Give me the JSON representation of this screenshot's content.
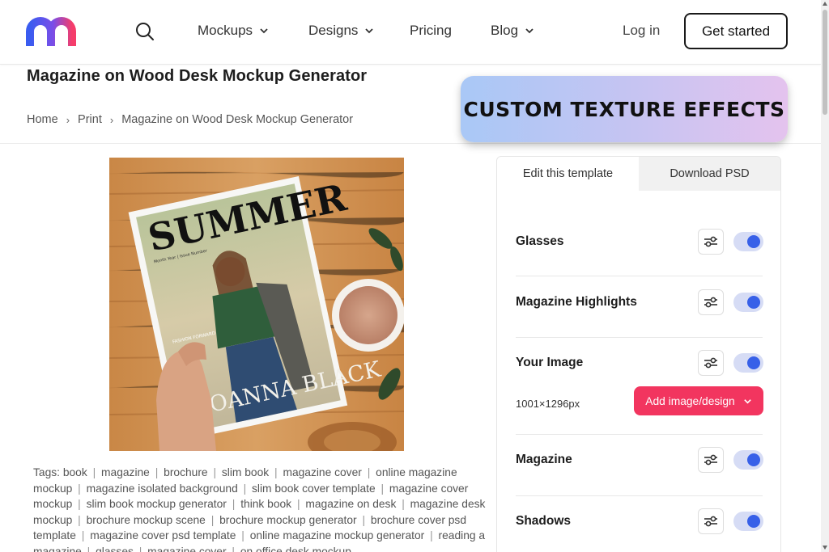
{
  "header": {
    "nav": [
      {
        "label": "Mockups",
        "has_dropdown": true
      },
      {
        "label": "Designs",
        "has_dropdown": true
      },
      {
        "label": "Pricing",
        "has_dropdown": false
      },
      {
        "label": "Blog",
        "has_dropdown": true
      }
    ],
    "login_label": "Log in",
    "cta_label": "Get started"
  },
  "page": {
    "title": "Magazine on Wood Desk Mockup Generator",
    "breadcrumb": [
      "Home",
      "Print",
      "Magazine on Wood Desk Mockup Generator"
    ]
  },
  "promo": {
    "text": "CUSTOM TEXTURE EFFECTS"
  },
  "mockup": {
    "cover_title": "SUMMER",
    "cover_name": "JOANNA BLACK",
    "cover_small": "Month Year | Issue Number",
    "cover_blurb": "FASHION FORWARD"
  },
  "tags": {
    "label": "Tags:",
    "items": [
      "book",
      "magazine",
      "brochure",
      "slim book",
      "magazine cover",
      "online magazine mockup",
      "magazine isolated background",
      "slim book cover template",
      "magazine cover mockup",
      "slim book mockup generator",
      "think book",
      "magazine on desk",
      "magazine desk mockup",
      "brochure mockup scene",
      "brochure mockup generator",
      "brochure cover psd template",
      "magazine cover psd template",
      "online magazine mockup generator",
      "reading a magazine",
      "glasses",
      "magazine cover",
      "on office desk mockup"
    ]
  },
  "editor": {
    "tabs": [
      "Edit this template",
      "Download PSD"
    ],
    "layers": [
      {
        "name": "Glasses",
        "enabled": true
      },
      {
        "name": "Magazine Highlights",
        "enabled": true
      },
      {
        "name": "Your Image",
        "enabled": true,
        "size": "1001×1296px",
        "button": "Add image/design"
      },
      {
        "name": "Magazine",
        "enabled": true
      },
      {
        "name": "Shadows",
        "enabled": true
      }
    ]
  },
  "colors": {
    "accent": "#f2355f",
    "toggle": "#3760e8",
    "logo_blue": "#3a5cf0",
    "logo_pink": "#f53d6a"
  }
}
